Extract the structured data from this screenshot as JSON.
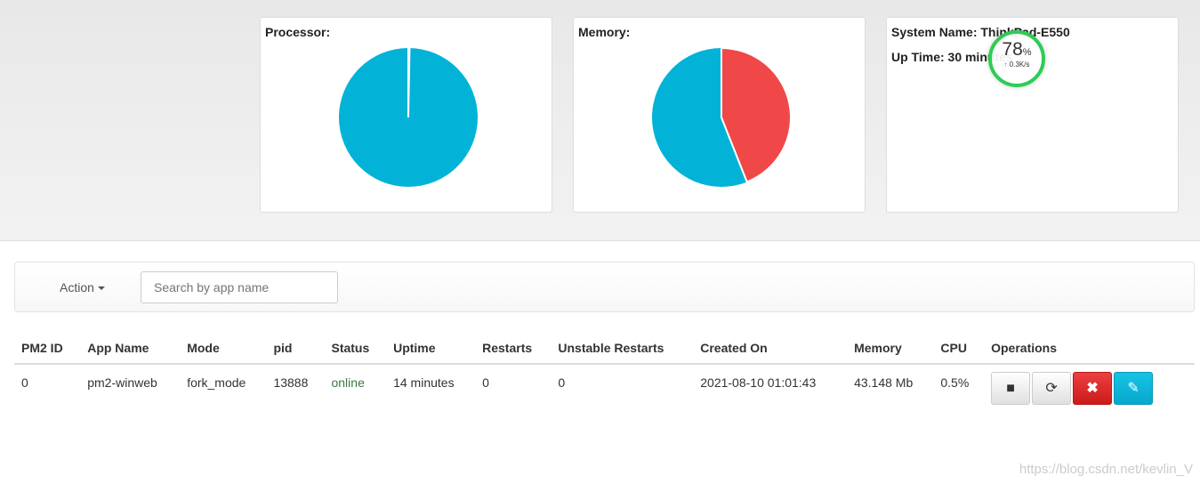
{
  "processor": {
    "title": "Processor:",
    "used_percent": 0.3,
    "colors": {
      "used": "#f04848",
      "free": "#02b3d7"
    }
  },
  "memory": {
    "title": "Memory:",
    "used_percent": 44,
    "colors": {
      "used": "#f04848",
      "free": "#02b3d7"
    }
  },
  "system": {
    "name_label": "System Name: ThinkPad-E550",
    "uptime_label": "Up Time: 30 minutes"
  },
  "widget": {
    "percent": "78",
    "unit": "%",
    "net": "0.3K/s"
  },
  "toolbar": {
    "action_label": "Action",
    "search_placeholder": "Search by app name"
  },
  "table": {
    "headers": [
      "PM2 ID",
      "App Name",
      "Mode",
      "pid",
      "Status",
      "Uptime",
      "Restarts",
      "Unstable Restarts",
      "Created On",
      "Memory",
      "CPU",
      "Operations"
    ],
    "rows": [
      [
        "0",
        "pm2-winweb",
        "fork_mode",
        "13888",
        "online",
        "14 minutes",
        "0",
        "0",
        "2021-08-10 01:01:43",
        "43.148 Mb",
        "0.5%"
      ]
    ]
  },
  "watermark": "https://blog.csdn.net/kevlin_V"
}
